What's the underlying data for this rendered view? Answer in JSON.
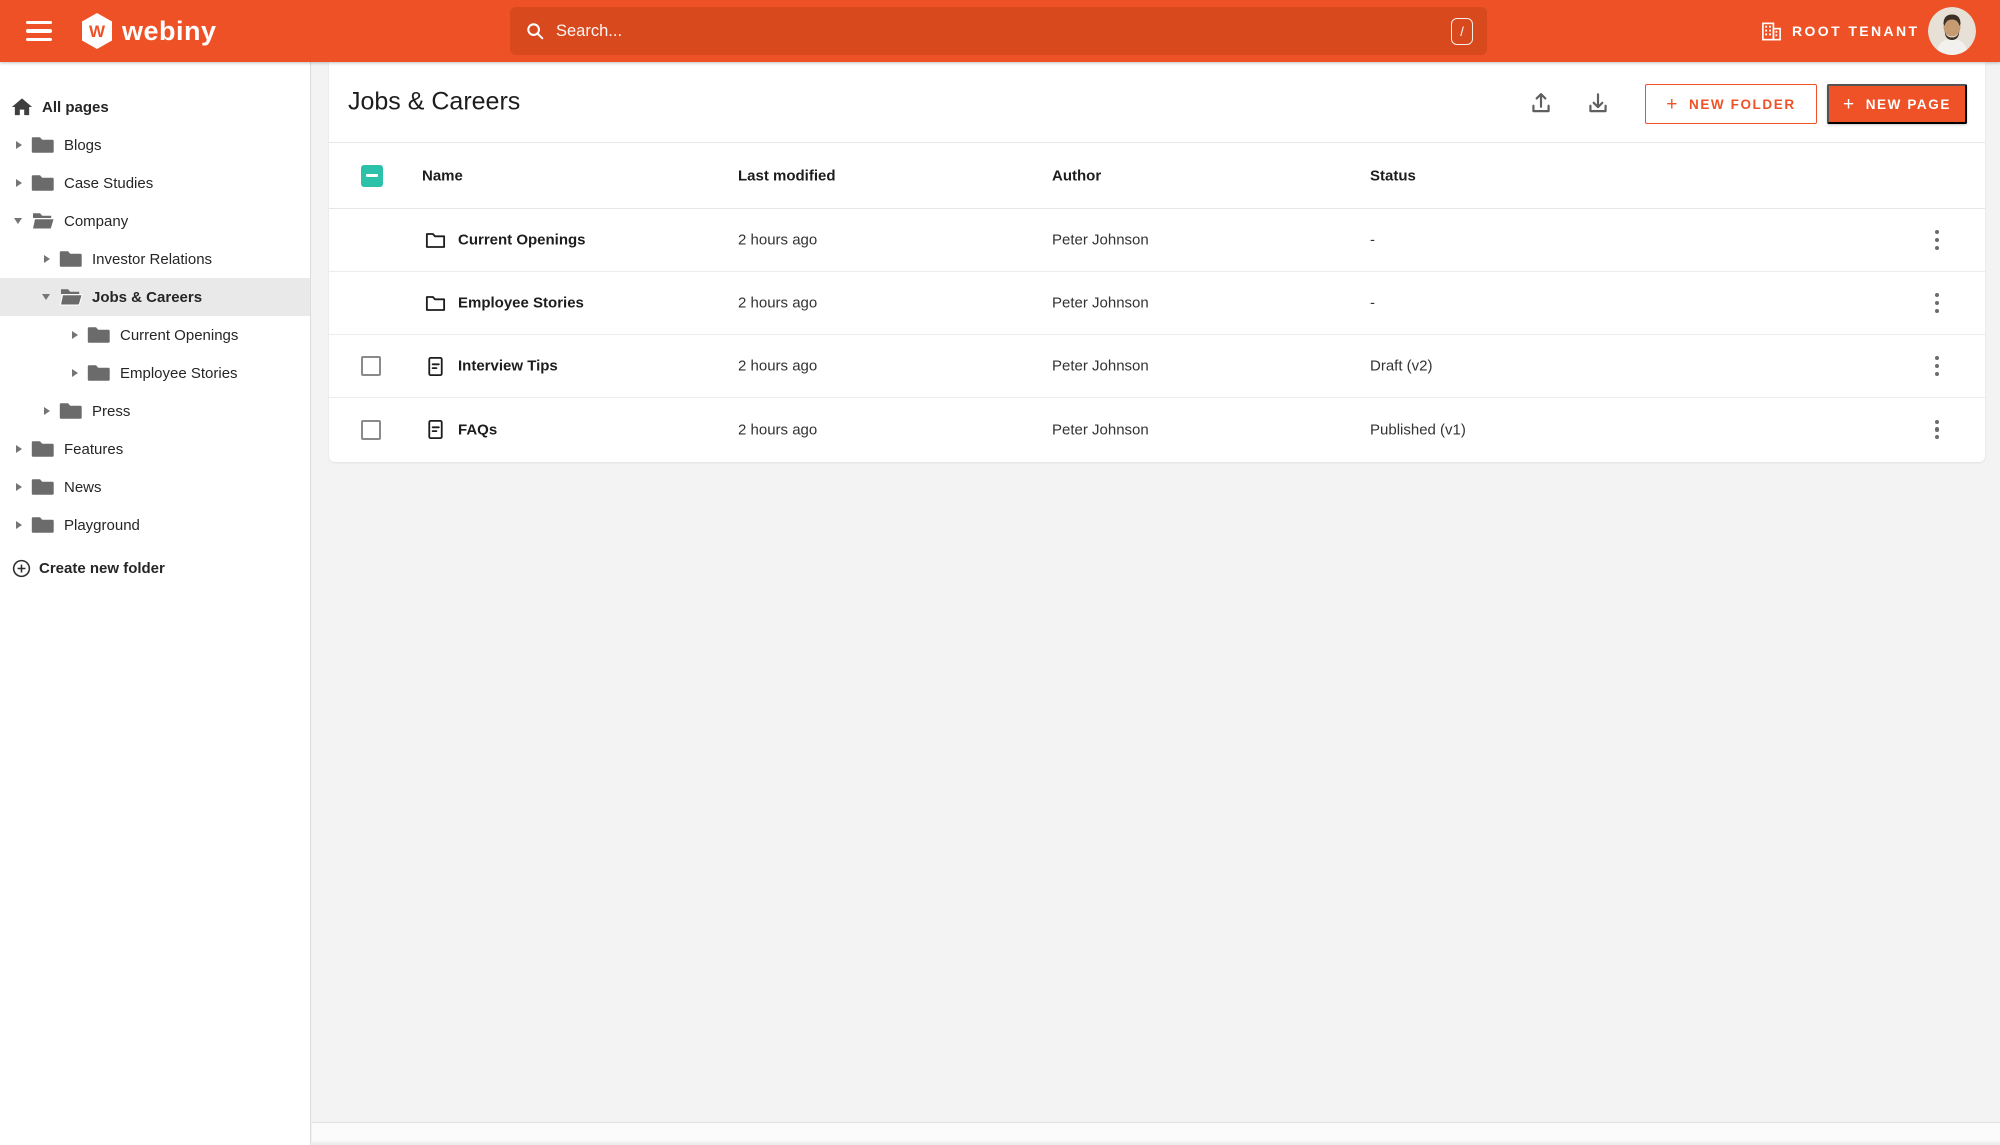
{
  "colors": {
    "topbar": "#EE5126",
    "searchbg": "#D8491D",
    "accent": "#EF5226",
    "teal": "#2BC2A9",
    "selbg": "#E9E9E9"
  },
  "topbar": {
    "brand": "webiny",
    "search": {
      "placeholder": "Search...",
      "shortcut": "/"
    },
    "tenant": "ROOT TENANT",
    "icons": [
      "menu-icon",
      "webiny-logo",
      "search-icon",
      "slash-shortcut-badge",
      "organization-icon",
      "user-avatar"
    ]
  },
  "sidebar": {
    "root_label": "All pages",
    "create_folder_label": "Create new folder",
    "items": [
      {
        "label": "Blogs",
        "level": 0,
        "state": "collapsed",
        "selected": false
      },
      {
        "label": "Case Studies",
        "level": 0,
        "state": "collapsed",
        "selected": false
      },
      {
        "label": "Company",
        "level": 0,
        "state": "expanded",
        "selected": false
      },
      {
        "label": "Investor Relations",
        "level": 1,
        "state": "collapsed",
        "selected": false
      },
      {
        "label": "Jobs & Careers",
        "level": 1,
        "state": "expanded",
        "selected": true
      },
      {
        "label": "Current Openings",
        "level": 2,
        "state": "collapsed",
        "selected": false
      },
      {
        "label": "Employee Stories",
        "level": 2,
        "state": "collapsed",
        "selected": false
      },
      {
        "label": "Press",
        "level": 1,
        "state": "collapsed",
        "selected": false
      },
      {
        "label": "Features",
        "level": 0,
        "state": "collapsed",
        "selected": false
      },
      {
        "label": "News",
        "level": 0,
        "state": "collapsed",
        "selected": false
      },
      {
        "label": "Playground",
        "level": 0,
        "state": "collapsed",
        "selected": false
      }
    ]
  },
  "main": {
    "title": "Jobs & Careers",
    "actions": {
      "new_folder": "NEW FOLDER",
      "new_page": "NEW PAGE",
      "plus": "+"
    },
    "header_icons": [
      "export-icon",
      "import-icon"
    ],
    "table": {
      "select_all_state": "indeterminate",
      "columns": [
        "Name",
        "Last modified",
        "Author",
        "Status"
      ],
      "rows": [
        {
          "name": "Current Openings",
          "type": "folder",
          "modified": "2 hours ago",
          "author": "Peter Johnson",
          "status": "-",
          "selectable": false
        },
        {
          "name": "Employee Stories",
          "type": "folder",
          "modified": "2 hours ago",
          "author": "Peter Johnson",
          "status": "-",
          "selectable": false
        },
        {
          "name": "Interview Tips",
          "type": "page",
          "modified": "2 hours ago",
          "author": "Peter Johnson",
          "status": "Draft (v2)",
          "selectable": true
        },
        {
          "name": "FAQs",
          "type": "page",
          "modified": "2 hours ago",
          "author": "Peter Johnson",
          "status": "Published (v1)",
          "selectable": true
        }
      ]
    }
  }
}
